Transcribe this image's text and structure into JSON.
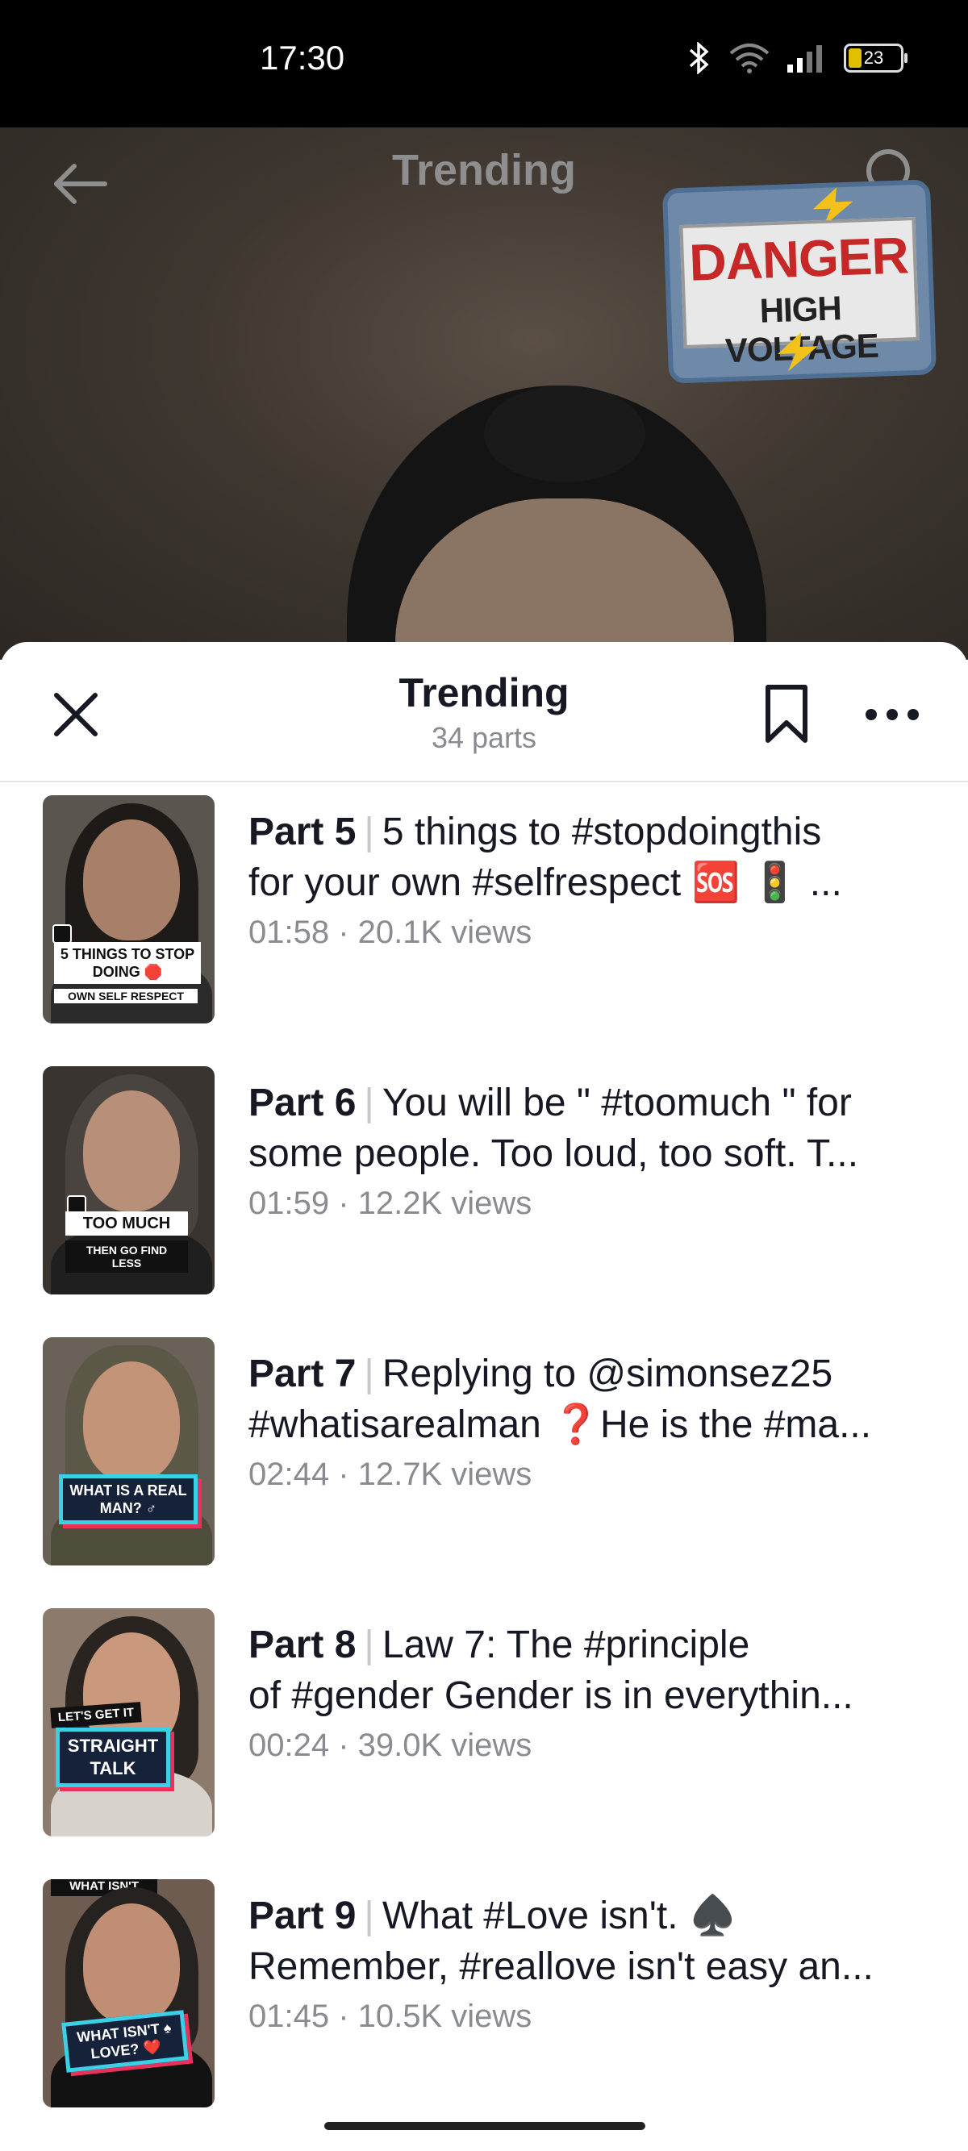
{
  "status_bar": {
    "time": "17:30",
    "battery": "23",
    "icons": [
      "bluetooth-icon",
      "wifi-icon",
      "signal-icon",
      "battery-icon"
    ]
  },
  "video": {
    "title": "Trending",
    "sticker_line1": "DANGER",
    "sticker_line2": "HIGH VOLTAGE"
  },
  "sheet": {
    "title": "Trending",
    "subtitle": "34 parts"
  },
  "separator": "|",
  "items": [
    {
      "part": "Part 5",
      "line1": "5 things to #stopdoingthis",
      "line2": "for your own #selfrespect 🆘 🚦 ...",
      "meta": "01:58 · 20.1K views",
      "thumb_label": "5 THINGS TO STOP DOING 🛑",
      "thumb_caption": "OWN SELF RESPECT"
    },
    {
      "part": "Part 6",
      "line1": "You will be \" #toomuch \" for",
      "line2": "some people. Too loud, too soft. T...",
      "meta": "01:59 · 12.2K views",
      "thumb_label": "TOO MUCH",
      "thumb_caption": "THEN GO FIND LESS"
    },
    {
      "part": "Part 7",
      "line1": "Replying to @simonsez25",
      "line2": "#whatisarealman ❓He is the #ma...",
      "meta": "02:44 · 12.7K views",
      "thumb_label": "WHAT IS A REAL MAN? ♂",
      "thumb_caption": ""
    },
    {
      "part": "Part 8",
      "line1": "Law 7: The #principle",
      "line2": "of #gender  Gender is in everythin...",
      "meta": "00:24 · 39.0K views",
      "thumb_label": "STRAIGHT TALK",
      "thumb_caption": "LET'S GET IT"
    },
    {
      "part": "Part 9",
      "line1": "What #Love isn't. ♠️",
      "line2": "Remember, #reallove isn't easy an...",
      "meta": "01:45 · 10.5K views",
      "thumb_label": "WHAT ISN'T ♠ LOVE? ❤️",
      "thumb_caption": "WHAT ISN'T"
    }
  ]
}
